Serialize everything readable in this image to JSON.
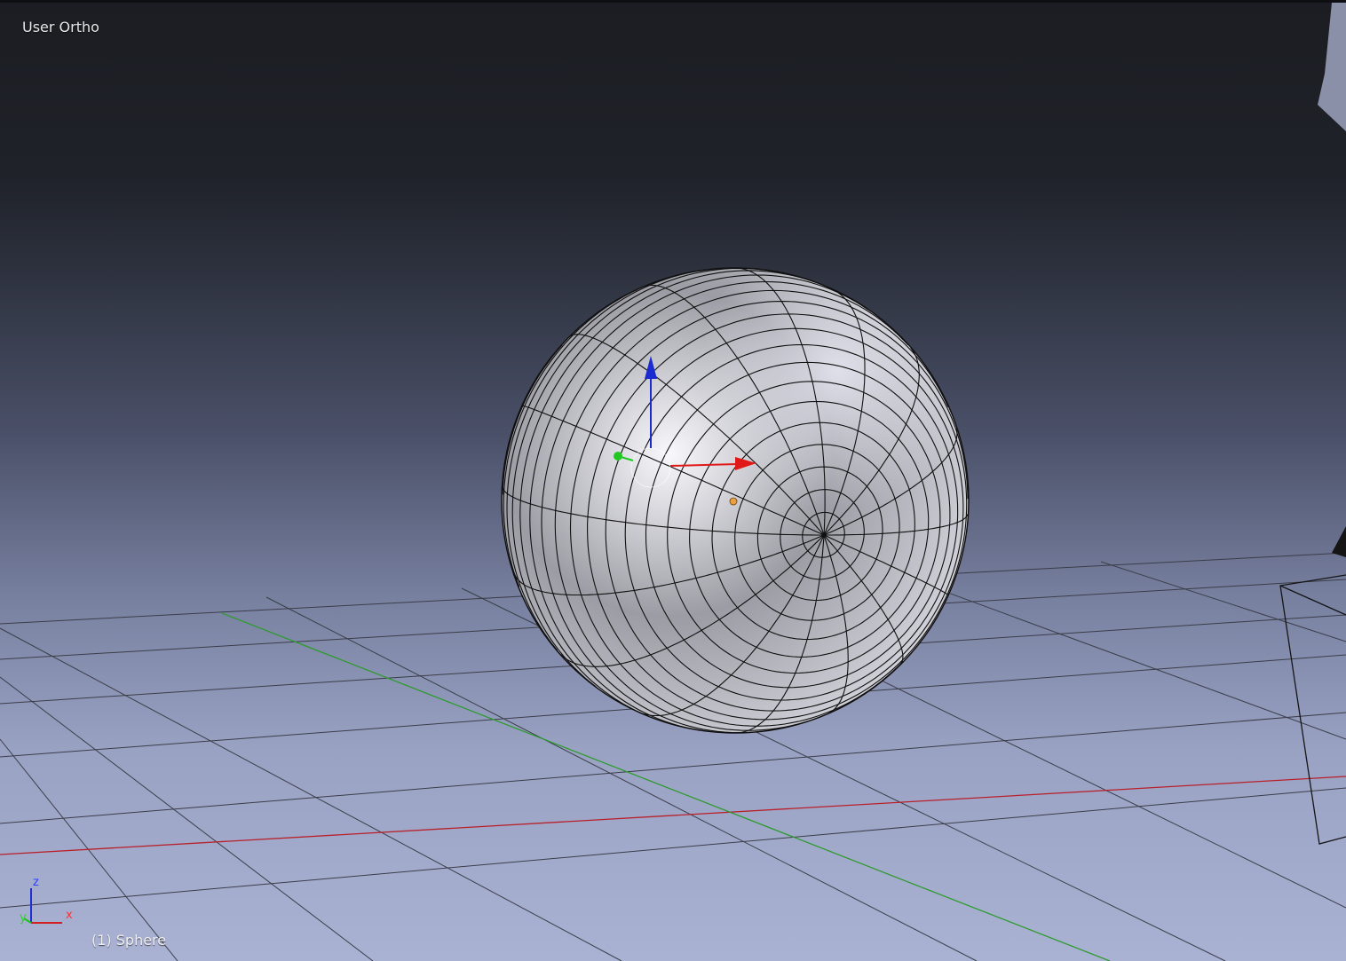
{
  "viewport": {
    "view_label": "User Ortho",
    "object_label": "(1) Sphere",
    "active_object": "Sphere",
    "shading": "solid",
    "overlay": "wireframe"
  },
  "axis_widget": {
    "z_label": "z",
    "x_label": "x",
    "y_label": "y"
  },
  "manipulator": {
    "z_axis_color": "#1a2bd0",
    "x_axis_color": "#e01818",
    "y_axis_color": "#22c822"
  },
  "colors": {
    "background_top": "#1b1d22",
    "background_bottom": "#a8b0d0",
    "grid_line": "#3a3d48",
    "x_axis_line": "#b8202a",
    "y_axis_line": "#2f9a2f",
    "sphere_wire": "#101010",
    "origin_point": "#e8a040"
  }
}
